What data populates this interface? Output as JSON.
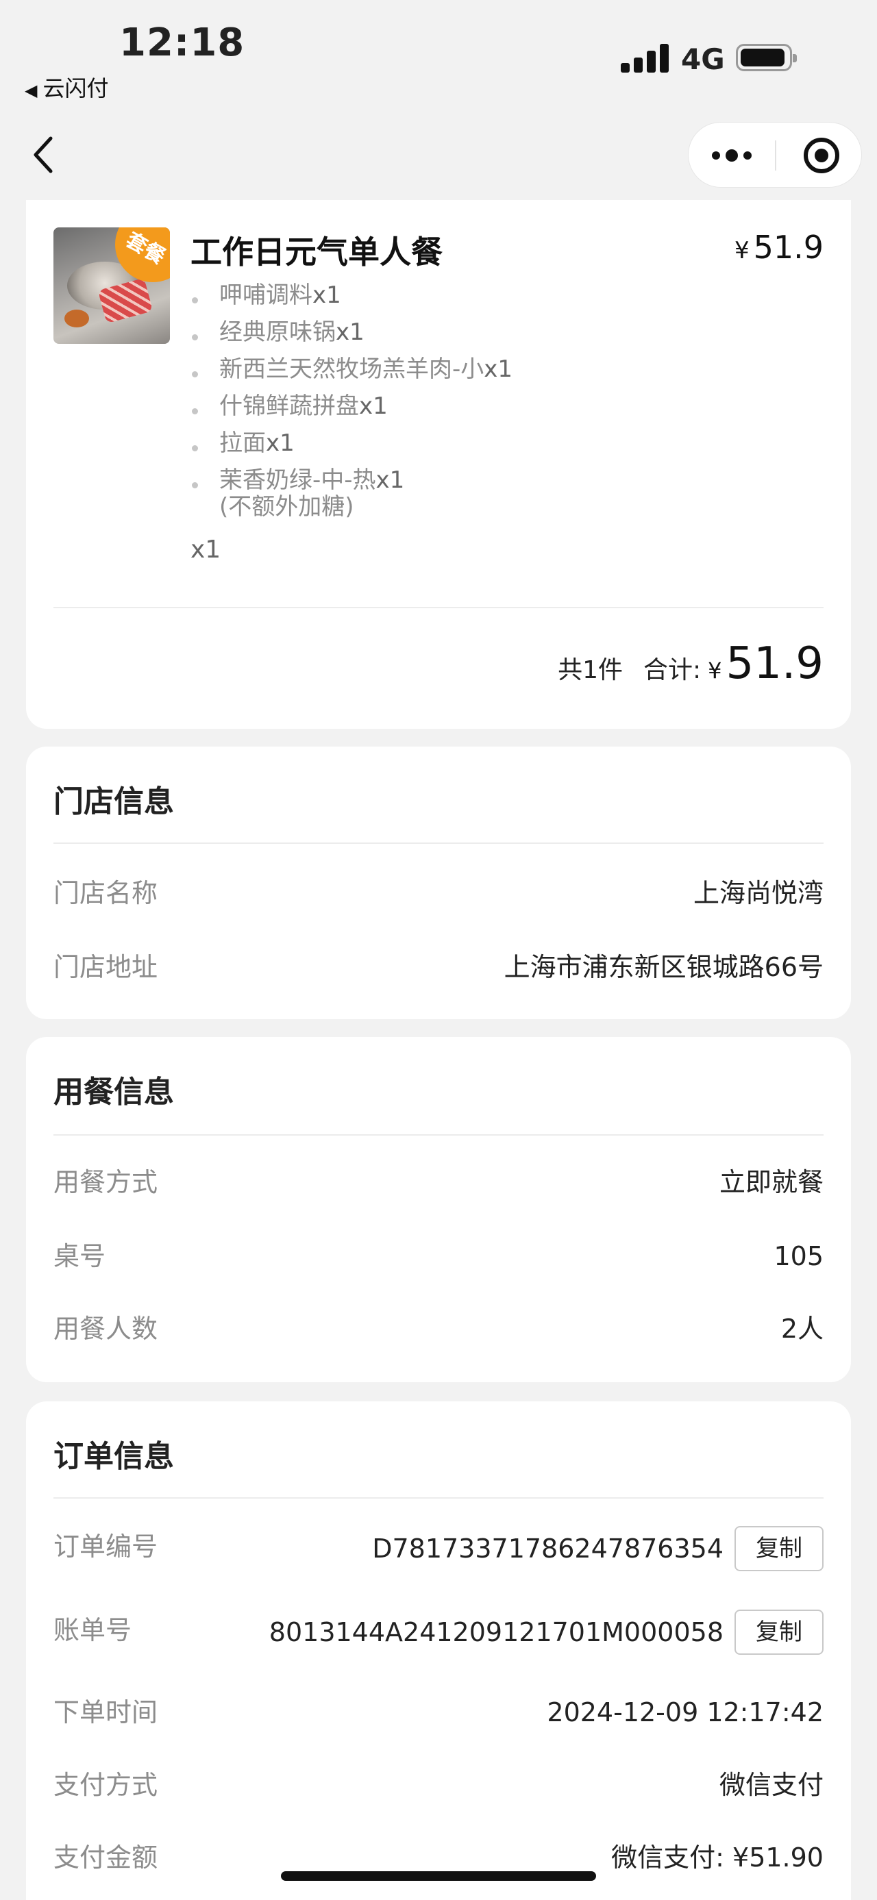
{
  "status_bar": {
    "time": "12:18",
    "back_app": "云闪付",
    "network": "4G"
  },
  "order": {
    "dish_name": "工作日元气单人餐",
    "badge": "套餐",
    "currency": "¥",
    "price": "51.9",
    "items": [
      {
        "name": "呷哺调料",
        "qty": "x1"
      },
      {
        "name": "经典原味锅",
        "qty": "x1"
      },
      {
        "name": "新西兰天然牧场羔羊肉-小",
        "qty": "x1"
      },
      {
        "name": "什锦鲜蔬拼盘",
        "qty": "x1"
      },
      {
        "name": "拉面",
        "qty": "x1"
      },
      {
        "name": "茉香奶绿-中-热",
        "qty": "x1"
      }
    ],
    "note": "(不额外加糖)",
    "dish_qty": "x1",
    "count_text": "共1件",
    "total_label": "合计:",
    "total_amount": "51.9"
  },
  "store": {
    "title": "门店信息",
    "rows": [
      {
        "key": "门店名称",
        "value": "上海尚悦湾"
      },
      {
        "key": "门店地址",
        "value": "上海市浦东新区银城路66号"
      }
    ]
  },
  "dining": {
    "title": "用餐信息",
    "rows": [
      {
        "key": "用餐方式",
        "value": "立即就餐"
      },
      {
        "key": "桌号",
        "value": "105"
      },
      {
        "key": "用餐人数",
        "value": "2人"
      }
    ]
  },
  "order_info": {
    "title": "订单信息",
    "copy_label": "复制",
    "rows": [
      {
        "key": "订单编号",
        "value": "D78173371786247876354"
      },
      {
        "key": "账单号",
        "value": "8013144A241209121701M000058"
      },
      {
        "key": "下单时间",
        "value": "2024-12-09 12:17:42"
      },
      {
        "key": "支付方式",
        "value": "微信支付"
      },
      {
        "key": "支付金额",
        "value": "微信支付: ¥51.90"
      }
    ]
  }
}
